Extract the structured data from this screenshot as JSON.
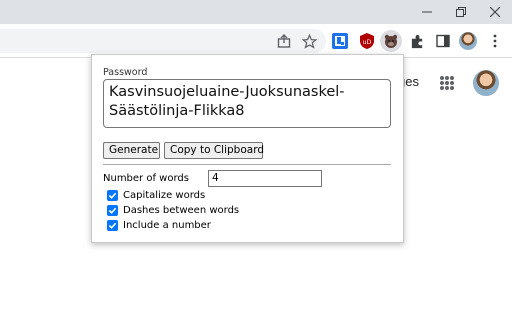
{
  "browser": {
    "extension_accent": "#0075ff",
    "icons": [
      "share-icon",
      "star-icon",
      "extension-blue-icon",
      "ublock-icon",
      "password-generator-icon",
      "puzzle-icon",
      "sidebar-icon",
      "profile-avatar",
      "kebab-menu-icon"
    ],
    "window_controls": [
      "minimize-icon",
      "restore-icon",
      "close-icon"
    ]
  },
  "page": {
    "images_link": "ges"
  },
  "popup": {
    "password_label": "Password",
    "password_value": "Kasvinsuojeluaine-Juoksunaskel-Säästölinja-Flikka8",
    "generate_label": "Generate",
    "copy_label": "Copy to Clipboard",
    "words_label": "Number of words",
    "words_value": "4",
    "options": [
      {
        "label": "Capitalize words",
        "checked": true
      },
      {
        "label": "Dashes between words",
        "checked": true
      },
      {
        "label": "Include a number",
        "checked": true
      }
    ]
  }
}
